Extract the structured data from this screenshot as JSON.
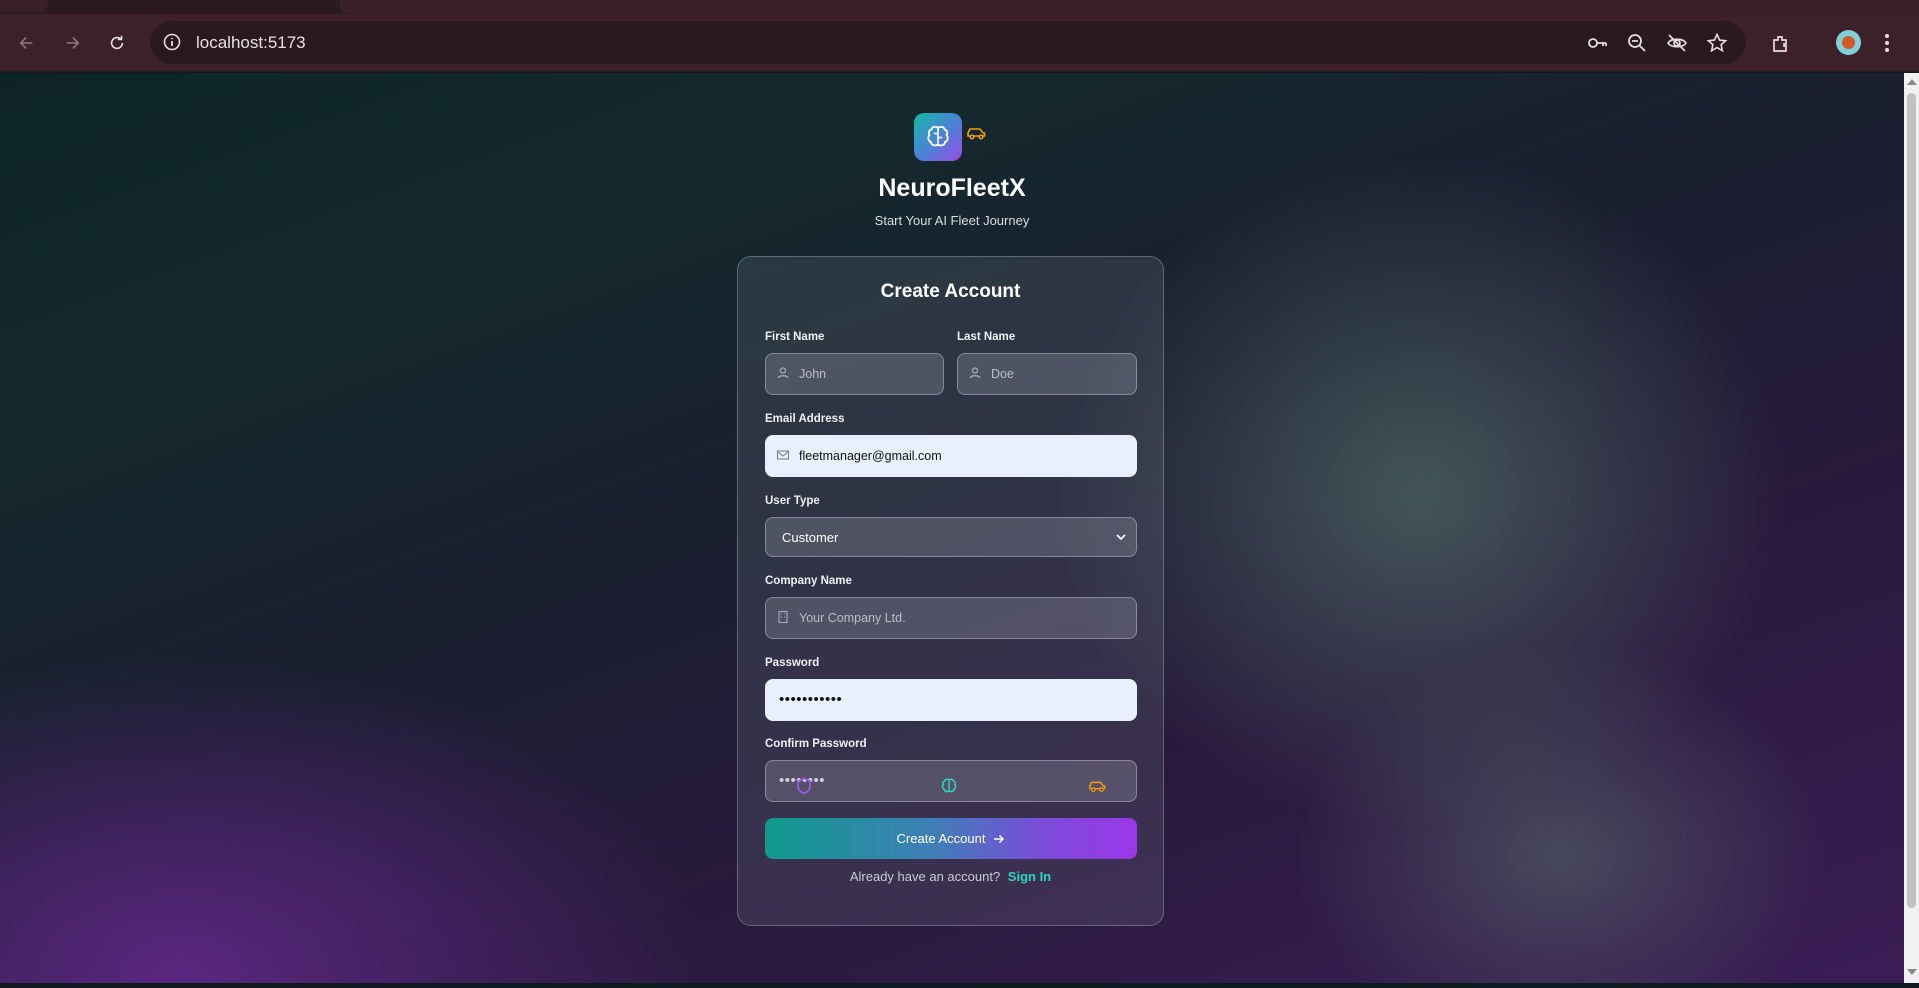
{
  "browser": {
    "url": "localhost:5173"
  },
  "app": {
    "brand": "NeuroFleetX",
    "tagline": "Start Your AI Fleet Journey"
  },
  "form": {
    "title": "Create Account",
    "first_name": {
      "label": "First Name",
      "placeholder": "John"
    },
    "last_name": {
      "label": "Last Name",
      "placeholder": "Doe"
    },
    "email": {
      "label": "Email Address",
      "value": "fleetmanager@gmail.com"
    },
    "user_type": {
      "label": "User Type",
      "selected": "Customer"
    },
    "company": {
      "label": "Company Name",
      "placeholder": "Your Company Ltd."
    },
    "password": {
      "label": "Password",
      "masked": "•••••••••••"
    },
    "confirm_password": {
      "label": "Confirm Password",
      "masked": "••••••••"
    },
    "submit_label": "Create Account",
    "signin_prompt": "Already have an account?",
    "signin_link": "Sign In"
  },
  "colors": {
    "accent_teal": "#2dd4bf",
    "accent_purple": "#9b37ea",
    "car_orange": "#f59e0b"
  },
  "icons": [
    "shield-icon",
    "brain-icon",
    "car-icon"
  ]
}
